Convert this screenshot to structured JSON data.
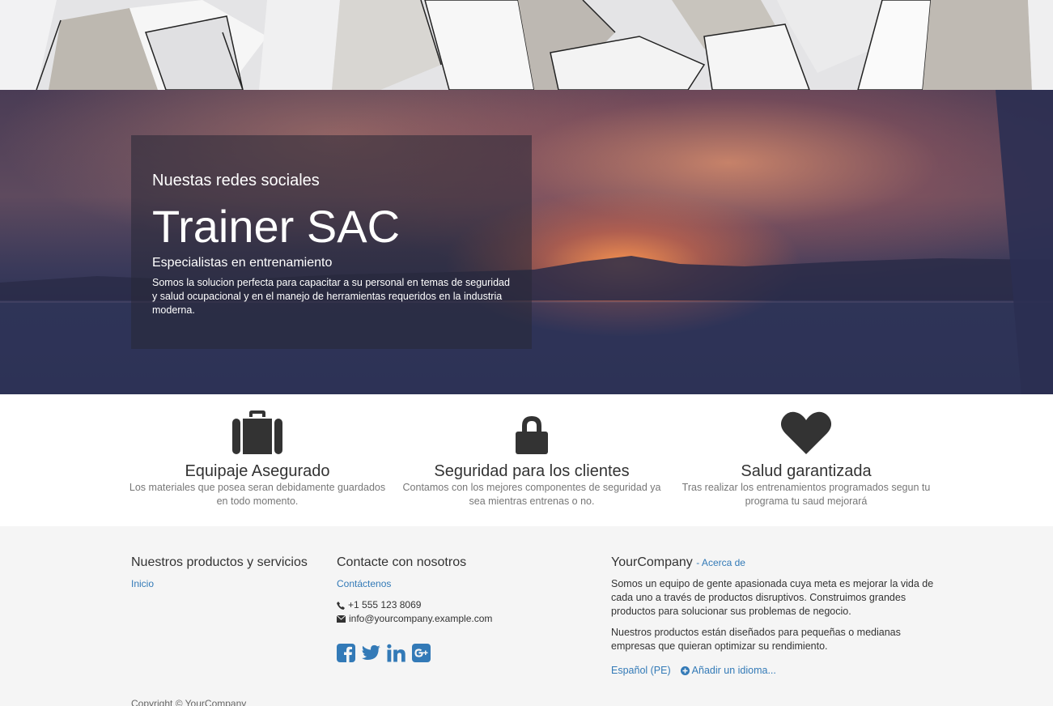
{
  "hero": {
    "kicker": "Nuestas redes sociales",
    "title": "Trainer SAC",
    "subtitle": "Especialistas en entrenamiento",
    "text": "Somos la solucion perfecta para capacitar a su personal en temas de seguridad y salud ocupacional y en el manejo de herramientas requeridos en la industria moderna."
  },
  "features": [
    {
      "icon": "briefcase-icon",
      "title": "Equipaje Asegurado",
      "text": "Los materiales que posea seran debidamente guardados en todo momento."
    },
    {
      "icon": "lock-icon",
      "title": "Seguridad para los clientes",
      "text": "Contamos con los mejores componentes de seguridad ya sea mientras entrenas o no."
    },
    {
      "icon": "heart-icon",
      "title": "Salud garantizada",
      "text": "Tras realizar los entrenamientos programados segun tu programa tu saud mejorará"
    }
  ],
  "footer": {
    "products": {
      "heading": "Nuestros productos y servicios",
      "link": "Inicio"
    },
    "contact": {
      "heading": "Contacte con nosotros",
      "link": "Contáctenos",
      "phone": "+1 555 123 8069",
      "email": "info@yourcompany.example.com",
      "social_icons": [
        "facebook-icon",
        "twitter-icon",
        "linkedin-icon",
        "google-plus-icon"
      ]
    },
    "about": {
      "company": "YourCompany",
      "about_link": "- Acerca de",
      "para1": "Somos un equipo de gente apasionada cuya meta es mejorar la vida de cada uno a través de productos disruptivos. Construimos grandes productos para solucionar sus problemas de negocio.",
      "para2": "Nuestros productos están diseñados para pequeñas o medianas empresas que quieran optimizar su rendimiento.",
      "language": "Español (PE)",
      "add_language": "Añadir un idioma..."
    },
    "copyright": "Copyright © YourCompany"
  },
  "colors": {
    "link": "#337ab7",
    "icon": "#333333",
    "footer_bg": "#f5f5f5"
  }
}
